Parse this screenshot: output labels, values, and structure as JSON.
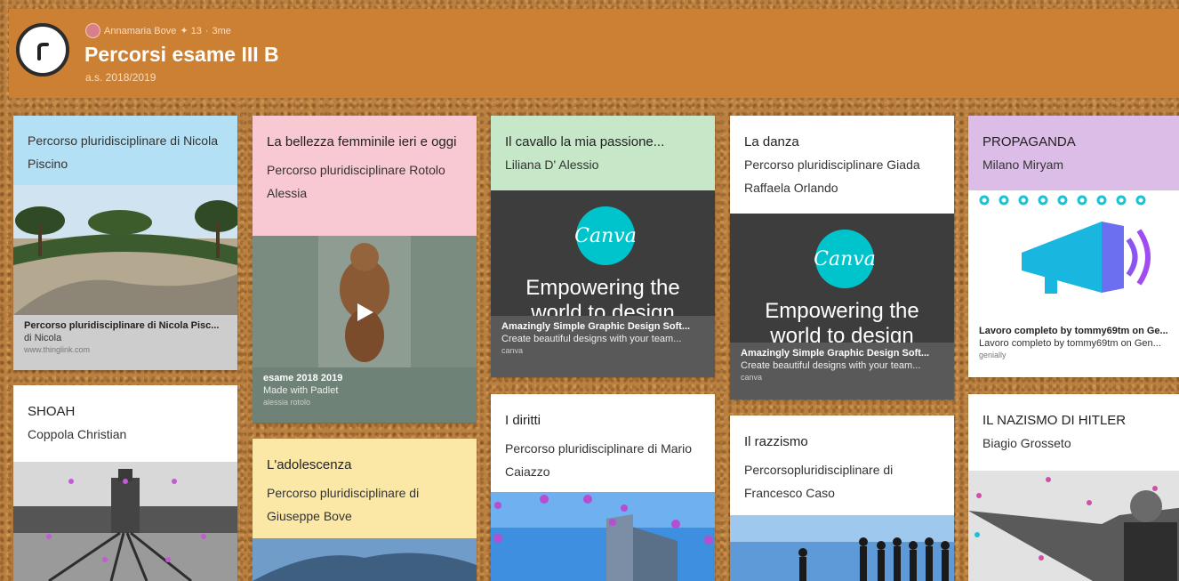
{
  "board": {
    "author": "Annamaria Bove",
    "likes": "✦ 13",
    "age": "3me",
    "title": "Percorsi esame III B",
    "subtitle": "a.s. 2018/2019"
  },
  "columns": [
    {
      "cards": [
        {
          "color": "#b3e0f5",
          "title": "Percorso pluridisciplinare di Nicola Piscino",
          "link": {
            "title": "Percorso pluridisciplinare di Nicola Pisc...",
            "desc": "di Nicola",
            "source": "www.thinglink.com"
          }
        },
        {
          "color": "#ffffff",
          "title": "SHOAH",
          "body": "Coppola Christian"
        }
      ]
    },
    {
      "cards": [
        {
          "color": "#f8c9d2",
          "title": "La bellezza femminile ieri e oggi",
          "body": "Percorso pluridisciplinare Rotolo Alessia",
          "link": {
            "title": "esame 2018 2019",
            "desc": "Made with Padlet",
            "source": "alessia rotolo"
          }
        },
        {
          "color": "#fce8a6",
          "title": "L'adolescenza",
          "body": "Percorso pluridisciplinare di Giuseppe Bove"
        }
      ]
    },
    {
      "cards": [
        {
          "color": "#c6e8c8",
          "title": "Il cavallo la mia passione...",
          "body": "Liliana D' Alessio",
          "image_text": {
            "logo": "Canva",
            "line1": "Empowering the",
            "line2": "world to design"
          },
          "link": {
            "title": "Amazingly Simple Graphic Design Soft...",
            "desc": "Create beautiful designs with your team...",
            "source": "canva"
          }
        },
        {
          "color": "#ffffff",
          "title": "I diritti",
          "body": "Percorso pluridisciplinare di Mario Caiazzo"
        }
      ]
    },
    {
      "cards": [
        {
          "color": "#ffffff",
          "title": "La danza",
          "body": "Percorso pluridisciplinare Giada Raffaela Orlando",
          "image_text": {
            "logo": "Canva",
            "line1": "Empowering the",
            "line2": "world to design"
          },
          "link": {
            "title": "Amazingly Simple Graphic Design Soft...",
            "desc": "Create beautiful designs with your team...",
            "source": "canva"
          }
        },
        {
          "color": "#ffffff",
          "title": "Il razzismo",
          "body": "Percorsopluridisciplinare di Francesco Caso"
        }
      ]
    },
    {
      "cards": [
        {
          "color": "#dcbde8",
          "title": "PROPAGANDA",
          "body": "Milano Miryam",
          "link": {
            "title": "Lavoro completo by tommy69tm on Ge...",
            "desc": "Lavoro completo by tommy69tm on Gen...",
            "source": "genially"
          }
        },
        {
          "color": "#ffffff",
          "title": "IL NAZISMO DI HITLER",
          "body": "Biagio Grosseto"
        }
      ]
    }
  ]
}
